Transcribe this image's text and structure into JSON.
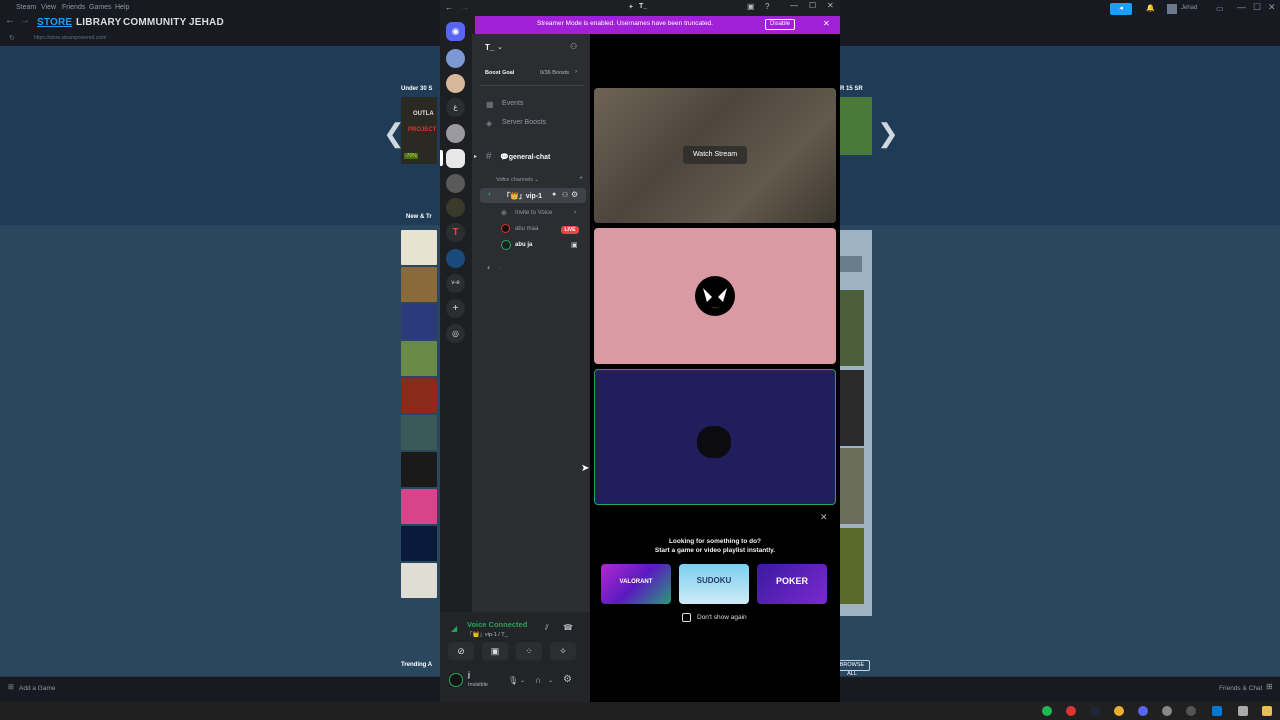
{
  "steam": {
    "menu": [
      "Steam",
      "View",
      "Friends",
      "Games",
      "Help"
    ],
    "nav": [
      "STORE",
      "LIBRARY",
      "COMMUNITY",
      "JEHAD"
    ],
    "url": "https://store.steampowered.com/",
    "username": "Jehad",
    "sections": {
      "under30": "Under 30 S",
      "new_trending": "New & Tr",
      "trending": "Trending A"
    },
    "sr_tag": "R 15 SR",
    "browse_all": "BROWSE ALL",
    "discount": "-70%",
    "bottom": {
      "add_game": "Add a Game",
      "friends_chat": "Friends & Chat"
    }
  },
  "discord": {
    "window_title": "T_",
    "streamer_banner": "Streamer Mode is enabled. Usernames have been truncated.",
    "disable_label": "Disable",
    "server_name": "T_",
    "boost_goal_label": "Boost Goal",
    "boost_count": "0/36 Boosts",
    "events_label": "Events",
    "server_boosts_label": "Server Boosts",
    "general_chat": "💬general-chat",
    "voice_channels_label": "Voice channels",
    "voice_channel_name": "「👑」vip-1",
    "invite_to_voice": "Invite to Voice",
    "user1": "abu maa",
    "live_badge": "LIVE",
    "user2": "abu ja",
    "extra_channel": ".",
    "guild_label_ve": "v-e",
    "watch_stream_label": "Watch Stream",
    "activity_prompt_title": "Looking for something to do?",
    "activity_prompt_sub": "Start a game or video playlist instantly.",
    "activities": [
      "VALORANT",
      "SUDOKU",
      "POKER"
    ],
    "dont_show_again": "Don't show again",
    "voice_connected": "Voice Connected",
    "voice_location": "「👑」vip-1 / T_",
    "user_status": "Invisible",
    "user_name": "j"
  },
  "colors": {
    "streamer": "#a021d8",
    "live": "#ed4245",
    "connected": "#23a55a"
  }
}
